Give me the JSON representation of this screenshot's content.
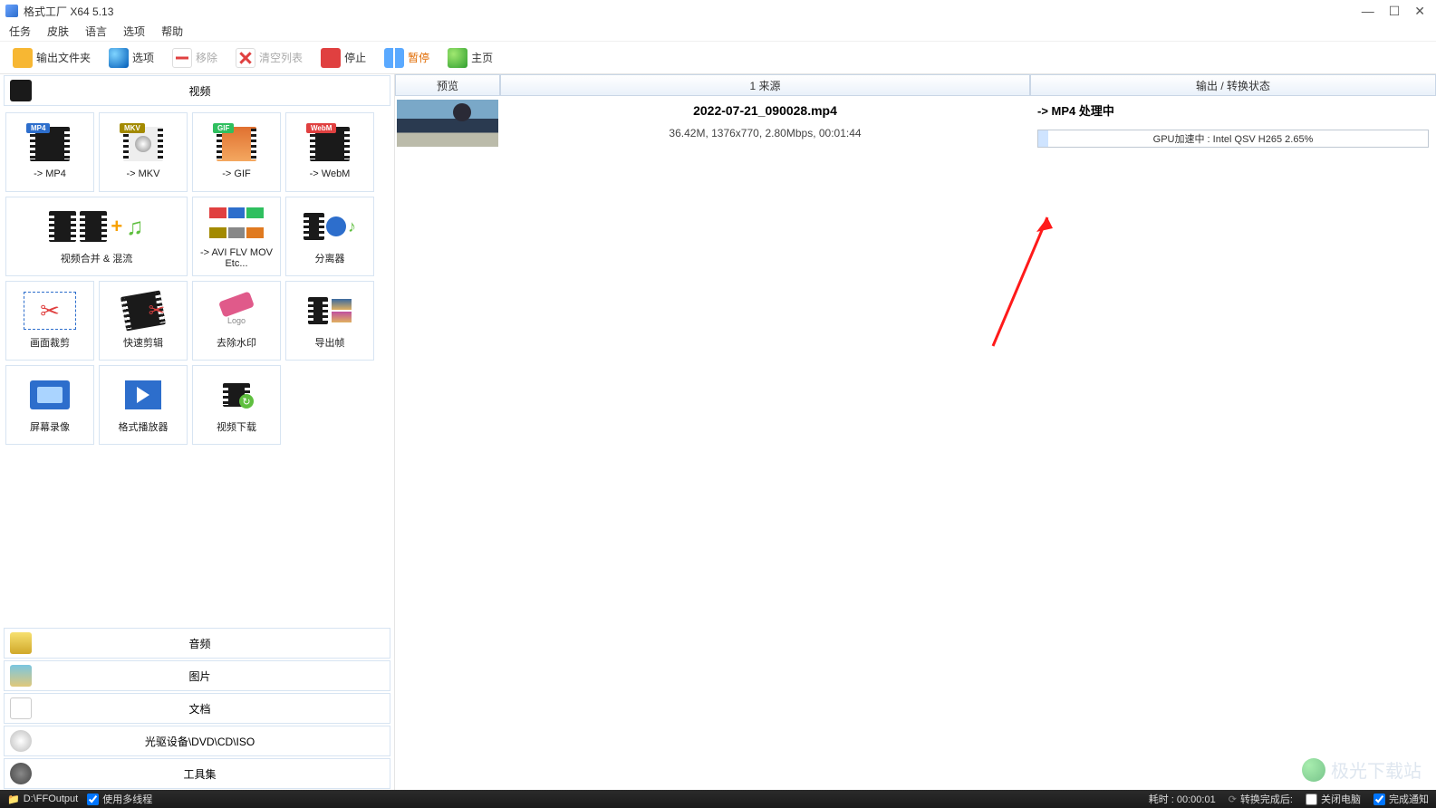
{
  "window": {
    "title": "格式工厂 X64 5.13"
  },
  "menu": {
    "task": "任务",
    "skin": "皮肤",
    "lang": "语言",
    "opt": "选项",
    "help": "帮助"
  },
  "toolbar": {
    "output_folder": "输出文件夹",
    "options": "选项",
    "remove": "移除",
    "clear_list": "清空列表",
    "stop": "停止",
    "pause": "暂停",
    "home": "主页"
  },
  "categories": {
    "video": "视频",
    "audio": "音频",
    "picture": "图片",
    "doc": "文档",
    "disc": "光驱设备\\DVD\\CD\\ISO",
    "tools": "工具集"
  },
  "video_grid": {
    "mp4": "-> MP4",
    "mkv": "-> MKV",
    "gif": "-> GIF",
    "webm": "-> WebM",
    "merge": "视频合并 & 混流",
    "avi_etc": "-> AVI FLV MOV Etc...",
    "splitter": "分离器",
    "crop": "画面裁剪",
    "quick_cut": "快速剪辑",
    "remove_wm": "去除水印",
    "export_frame": "导出帧",
    "screen_rec": "屏幕录像",
    "player": "格式播放器",
    "downloader": "视频下载"
  },
  "columns": {
    "preview": "预览",
    "source": "1 来源",
    "output": "输出 / 转换状态"
  },
  "task": {
    "filename": "2022-07-21_090028.mp4",
    "meta": "36.42M, 1376x770, 2.80Mbps, 00:01:44",
    "status": "->  MP4 处理中",
    "progress_text": "GPU加速中 : Intel QSV H265 2.65%",
    "progress_percent": 2.65
  },
  "statusbar": {
    "path": "D:\\FFOutput",
    "multithread": "使用多线程",
    "elapsed": "耗时 : 00:00:01",
    "after_convert": "转换完成后:",
    "shutdown": "关闭电脑",
    "notify": "完成通知"
  },
  "watermark": "极光下载站"
}
